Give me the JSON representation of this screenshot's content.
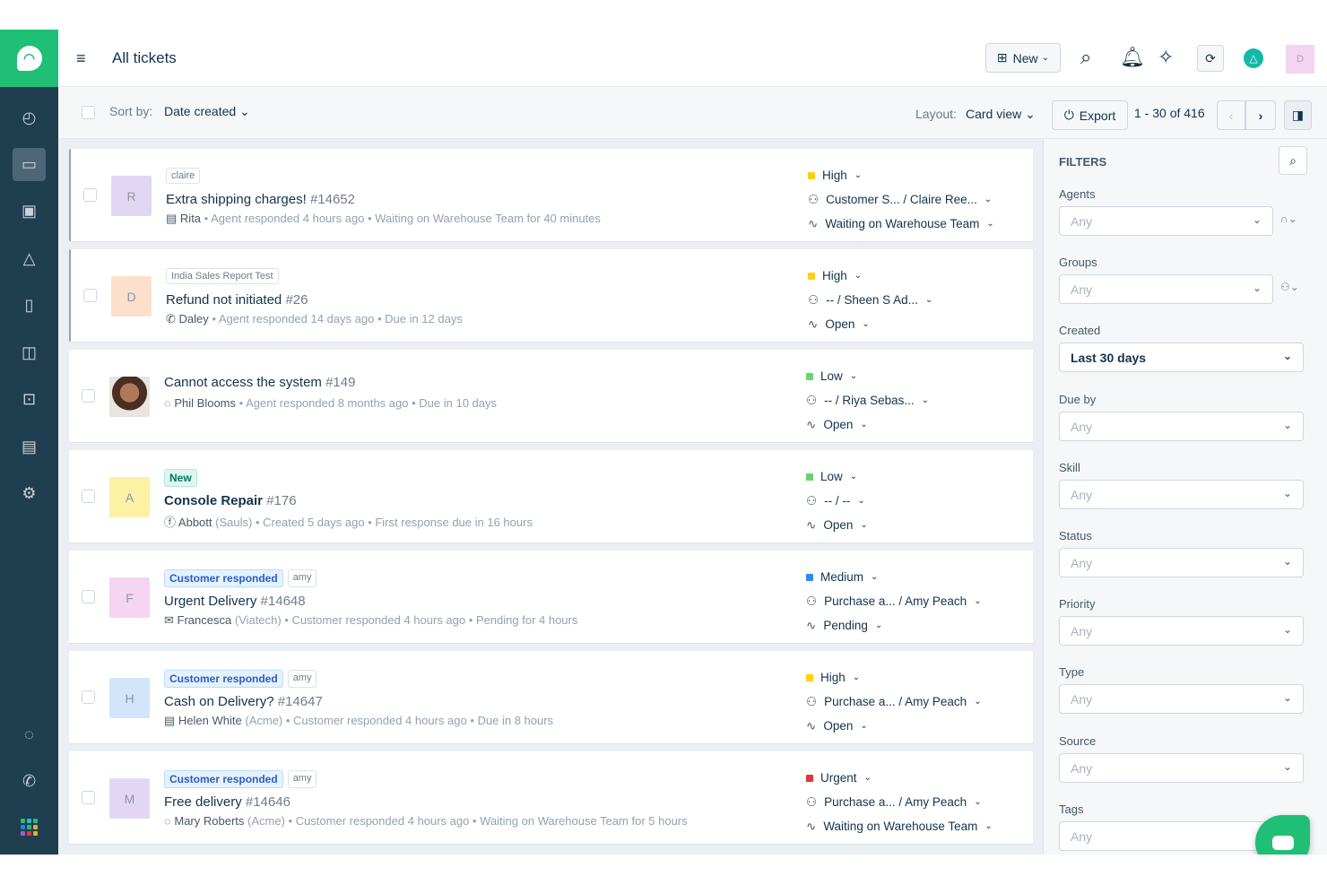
{
  "header": {
    "title": "All tickets",
    "new_label": "New",
    "avatar_initial": "D"
  },
  "toolbar": {
    "sort_label": "Sort by:",
    "sort_value": "Date created",
    "layout_label": "Layout:",
    "layout_value": "Card view",
    "export_label": "Export",
    "pagination": "1 - 30 of 416"
  },
  "tickets": [
    {
      "tags": [
        {
          "text": "claire",
          "style": "plain"
        }
      ],
      "avatar": "R",
      "avatar_color": "#e1d7f5",
      "subject": "Extra shipping charges!",
      "number": "#14652",
      "source_icon": "▤",
      "requester": "Rita",
      "company": "",
      "meta1": "Agent responded 4 hours ago",
      "meta2": "Waiting on Warehouse Team for 40 minutes",
      "priority": "High",
      "priority_color": "#ffd012",
      "assignee": "Customer S... / Claire Ree...",
      "status": "Waiting on Warehouse Team",
      "bold": false
    },
    {
      "tags": [
        {
          "text": "India Sales Report Test",
          "style": "plain"
        }
      ],
      "avatar": "D",
      "avatar_color": "#fde0cc",
      "subject": "Refund not initiated",
      "number": "#26",
      "source_icon": "✆",
      "requester": "Daley",
      "company": "",
      "meta1": "Agent responded 14 days ago",
      "meta2": "Due in 12 days",
      "priority": "High",
      "priority_color": "#ffd012",
      "assignee": "-- / Sheen S Ad...",
      "status": "Open",
      "bold": false
    },
    {
      "tags": [],
      "avatar": "",
      "avatar_color": "#d9c2ad",
      "subject": "Cannot access the system",
      "number": "#149",
      "source_icon": "◌",
      "requester": "Phil Blooms",
      "company": "",
      "meta1": "Agent responded 8 months ago",
      "meta2": "Due in 10 days",
      "priority": "Low",
      "priority_color": "#6bd36b",
      "assignee": "-- / Riya Sebas...",
      "status": "Open",
      "bold": false
    },
    {
      "tags": [
        {
          "text": "New",
          "style": "green"
        }
      ],
      "avatar": "A",
      "avatar_color": "#fdf1a4",
      "subject": "Console Repair",
      "number": "#176",
      "source_icon": "ⓕ",
      "requester": "Abbott",
      "company": "(Sauls)",
      "meta1": "Created 5 days ago",
      "meta2": "First response due in 16 hours",
      "priority": "Low",
      "priority_color": "#6bd36b",
      "assignee": "-- / --",
      "status": "Open",
      "bold": true
    },
    {
      "tags": [
        {
          "text": "Customer responded",
          "style": "blue"
        },
        {
          "text": "amy",
          "style": "plain"
        }
      ],
      "avatar": "F",
      "avatar_color": "#f5d5f2",
      "subject": "Urgent Delivery",
      "number": "#14648",
      "source_icon": "✉",
      "requester": "Francesca",
      "company": "(Viatech)",
      "meta1": "Customer responded 4 hours ago",
      "meta2": "Pending for 4 hours",
      "priority": "Medium",
      "priority_color": "#2c8cf4",
      "assignee": "Purchase a... / Amy Peach",
      "status": "Pending",
      "bold": false
    },
    {
      "tags": [
        {
          "text": "Customer responded",
          "style": "blue"
        },
        {
          "text": "amy",
          "style": "plain"
        }
      ],
      "avatar": "H",
      "avatar_color": "#d3e5fb",
      "subject": "Cash on Delivery?",
      "number": "#14647",
      "source_icon": "▤",
      "requester": "Helen White",
      "company": "(Acme)",
      "meta1": "Customer responded 4 hours ago",
      "meta2": "Due in 8 hours",
      "priority": "High",
      "priority_color": "#ffd012",
      "assignee": "Purchase a... / Amy Peach",
      "status": "Open",
      "bold": false
    },
    {
      "tags": [
        {
          "text": "Customer responded",
          "style": "blue"
        },
        {
          "text": "amy",
          "style": "plain"
        }
      ],
      "avatar": "M",
      "avatar_color": "#e1d7f5",
      "subject": "Free delivery",
      "number": "#14646",
      "source_icon": "◌",
      "requester": "Mary Roberts",
      "company": "(Acme)",
      "meta1": "Customer responded 4 hours ago",
      "meta2": "Waiting on Warehouse Team for 5 hours",
      "priority": "Urgent",
      "priority_color": "#e43538",
      "assignee": "Purchase a... / Amy Peach",
      "status": "Waiting on Warehouse Team",
      "bold": false
    }
  ],
  "filters": {
    "title": "FILTERS",
    "fields": [
      {
        "label": "Agents",
        "value": "Any"
      },
      {
        "label": "Groups",
        "value": "Any"
      },
      {
        "label": "Created",
        "value": "Last 30 days"
      },
      {
        "label": "Due by",
        "value": "Any"
      },
      {
        "label": "Skill",
        "value": "Any"
      },
      {
        "label": "Status",
        "value": "Any"
      },
      {
        "label": "Priority",
        "value": "Any"
      },
      {
        "label": "Type",
        "value": "Any"
      },
      {
        "label": "Source",
        "value": "Any"
      },
      {
        "label": "Tags",
        "value": "Any"
      }
    ]
  }
}
